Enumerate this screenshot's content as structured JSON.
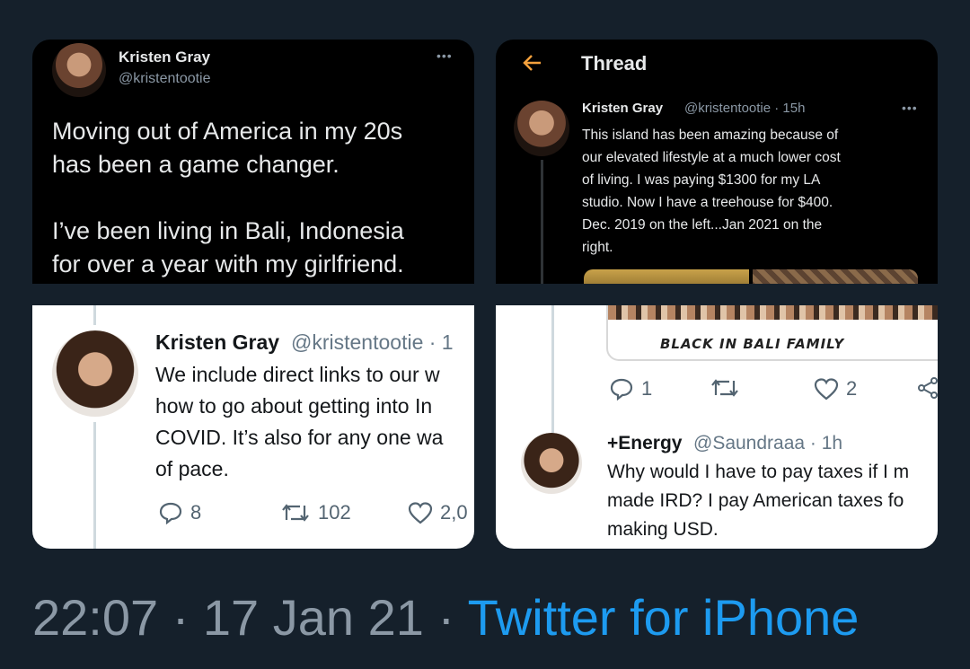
{
  "panel_tl": {
    "name": "Kristen Gray",
    "handle": "@kristentootie",
    "text": "Moving out of America in my 20s\nhas been a game changer.\n\nI’ve been living in Bali, Indonesia\nfor over a year with my girlfriend."
  },
  "panel_tr": {
    "header": "Thread",
    "name": "Kristen Gray",
    "handle": "@kristentootie · 15h",
    "text": "This island has been amazing because of\nour elevated lifestyle at a much lower cost\nof living. I was paying $1300 for my LA\nstudio. Now I have a treehouse for $400.\nDec. 2019 on the left...Jan 2021 on the\nright."
  },
  "panel_bl": {
    "name": "Kristen Gray",
    "handle": "@kristentootie · 1",
    "text": "We include direct links to our w\nhow to go about getting into In\nCOVID. It’s also for any one wa\nof pace.",
    "replies": "8",
    "retweets": "102",
    "likes": "2,0"
  },
  "panel_br": {
    "image_caption": "BLACK IN BALI FAMILY",
    "replies": "1",
    "likes": "2",
    "name": "+Energy",
    "handle": "@Saundraaa · 1h",
    "text": "Why would I have to pay taxes if I m\nmade IRD? I pay American taxes fo\nmaking USD."
  },
  "footer": {
    "time": "22:07",
    "sep1": " · ",
    "date": "17 Jan 21",
    "sep2": " · ",
    "source": "Twitter for iPhone"
  },
  "colors": {
    "background": "#15202b",
    "accent": "#1d9bf0",
    "secondary_text": "#8b98a5",
    "back_arrow": "#f4a13d"
  }
}
